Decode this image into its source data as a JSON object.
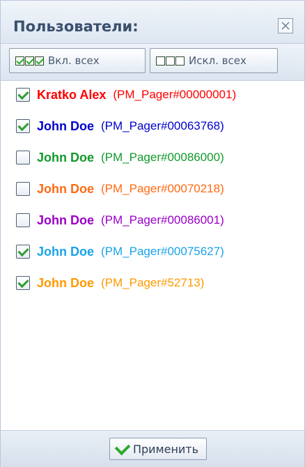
{
  "header": {
    "title": "Пользователи:"
  },
  "toolbar": {
    "select_all_label": "Вкл. всех",
    "deselect_all_label": "Искл. всех"
  },
  "users": [
    {
      "name": "Kratko Alex",
      "id": "(PM_Pager#00000001)",
      "checked": true,
      "color": "#ff0000"
    },
    {
      "name": "John Doe",
      "id": "(PM_Pager#00063768)",
      "checked": true,
      "color": "#0000cc"
    },
    {
      "name": "John Doe",
      "id": "(PM_Pager#00086000)",
      "checked": false,
      "color": "#119a2c"
    },
    {
      "name": "John Doe",
      "id": "(PM_Pager#00070218)",
      "checked": false,
      "color": "#ff6a14"
    },
    {
      "name": "John Doe",
      "id": "(PM_Pager#00086001)",
      "checked": false,
      "color": "#9b00c8"
    },
    {
      "name": "John Doe",
      "id": "(PM_Pager#00075627)",
      "checked": true,
      "color": "#1aa3e8"
    },
    {
      "name": "John Doe",
      "id": "(PM_Pager#52713)",
      "checked": true,
      "color": "#ff9a00"
    }
  ],
  "footer": {
    "apply_label": "Применить"
  }
}
